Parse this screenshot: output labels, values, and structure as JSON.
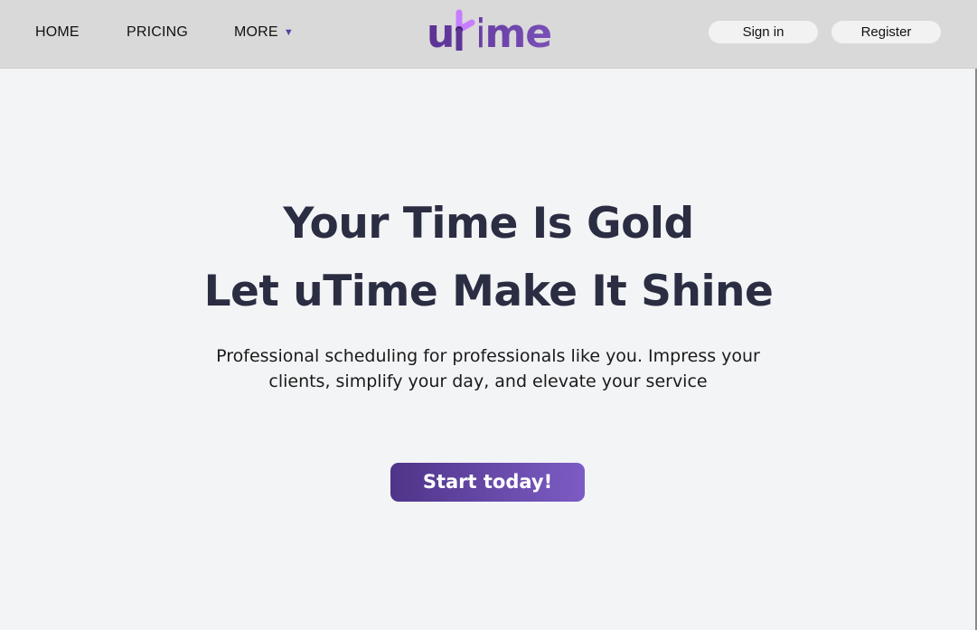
{
  "nav": {
    "home": "HOME",
    "pricing": "PRICING",
    "more": "MORE",
    "more_caret": "▼"
  },
  "logo": {
    "text": "utime",
    "icon": "clock-hand-icon",
    "colors": {
      "start": "#5b3294",
      "end": "#7a4fb8",
      "accent": "#c77dff"
    }
  },
  "auth": {
    "sign_in": "Sign in",
    "register": "Register"
  },
  "hero": {
    "title_line1": "Your Time Is Gold",
    "title_line2": "Let uTime Make It Shine",
    "subtitle": "Professional scheduling for professionals like you. Impress your clients, simplify your day, and elevate your service",
    "cta": "Start today!"
  },
  "colors": {
    "navbar_bg": "#d9d9d9",
    "page_bg": "#f3f4f6",
    "heading": "#2b2d42",
    "cta_start": "#4f3489",
    "cta_end": "#7c5cc4"
  }
}
